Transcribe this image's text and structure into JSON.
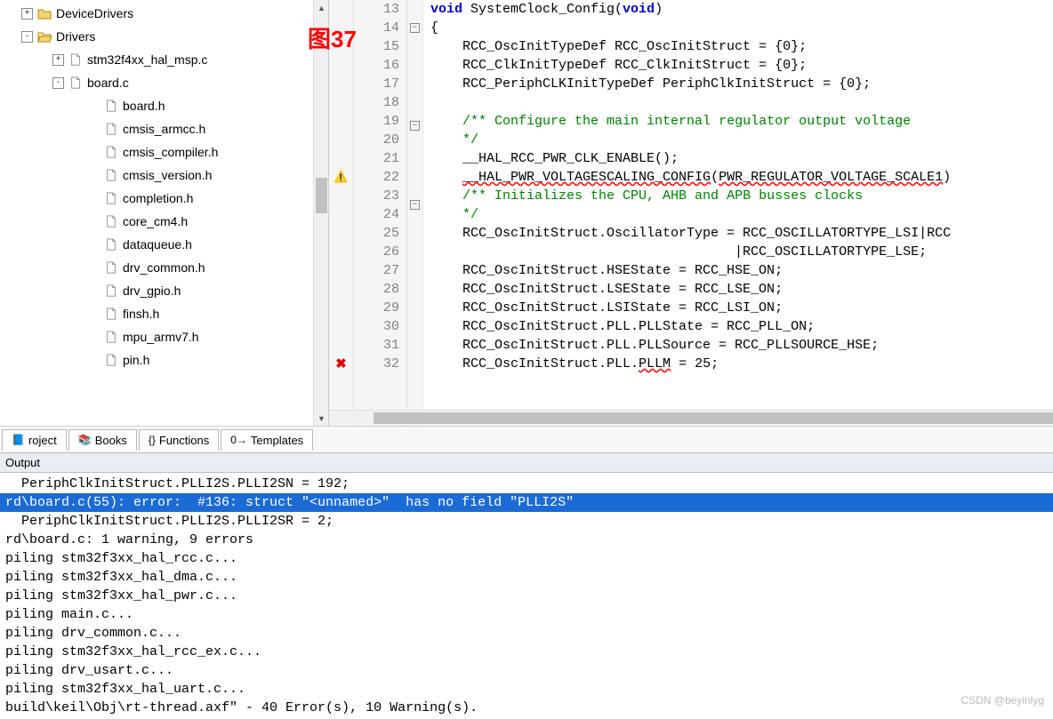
{
  "annotation": "图37",
  "tree": {
    "nodes": [
      {
        "indent": 20,
        "toggle": "+",
        "icon": "folder-closed",
        "label": "DeviceDrivers"
      },
      {
        "indent": 20,
        "toggle": "-",
        "icon": "folder-open",
        "label": "Drivers"
      },
      {
        "indent": 55,
        "toggle": "+",
        "icon": "file",
        "label": "stm32f4xx_hal_msp.c"
      },
      {
        "indent": 55,
        "toggle": "-",
        "icon": "file",
        "label": "board.c"
      },
      {
        "indent": 95,
        "toggle": "",
        "icon": "file",
        "label": "board.h"
      },
      {
        "indent": 95,
        "toggle": "",
        "icon": "file",
        "label": "cmsis_armcc.h"
      },
      {
        "indent": 95,
        "toggle": "",
        "icon": "file",
        "label": "cmsis_compiler.h"
      },
      {
        "indent": 95,
        "toggle": "",
        "icon": "file",
        "label": "cmsis_version.h"
      },
      {
        "indent": 95,
        "toggle": "",
        "icon": "file",
        "label": "completion.h"
      },
      {
        "indent": 95,
        "toggle": "",
        "icon": "file",
        "label": "core_cm4.h"
      },
      {
        "indent": 95,
        "toggle": "",
        "icon": "file",
        "label": "dataqueue.h"
      },
      {
        "indent": 95,
        "toggle": "",
        "icon": "file",
        "label": "drv_common.h"
      },
      {
        "indent": 95,
        "toggle": "",
        "icon": "file",
        "label": "drv_gpio.h"
      },
      {
        "indent": 95,
        "toggle": "",
        "icon": "file",
        "label": "finsh.h"
      },
      {
        "indent": 95,
        "toggle": "",
        "icon": "file",
        "label": "mpu_armv7.h"
      },
      {
        "indent": 95,
        "toggle": "",
        "icon": "file",
        "label": "pin.h"
      }
    ]
  },
  "editor": {
    "lines": [
      {
        "n": 13,
        "marker": "",
        "fold": "",
        "parts": [
          {
            "t": "void ",
            "c": "kw"
          },
          {
            "t": "SystemClock_Config("
          },
          {
            "t": "void",
            "c": "kw"
          },
          {
            "t": ")"
          }
        ]
      },
      {
        "n": 14,
        "marker": "",
        "fold": "-",
        "parts": [
          {
            "t": "{"
          }
        ]
      },
      {
        "n": 15,
        "marker": "",
        "fold": "",
        "parts": [
          {
            "t": "    RCC_OscInitTypeDef RCC_OscInitStruct = {0};"
          }
        ]
      },
      {
        "n": 16,
        "marker": "",
        "fold": "",
        "parts": [
          {
            "t": "    RCC_ClkInitTypeDef RCC_ClkInitStruct = {0};"
          }
        ]
      },
      {
        "n": 17,
        "marker": "",
        "fold": "",
        "parts": [
          {
            "t": "    RCC_PeriphCLKInitTypeDef PeriphClkInitStruct = {0};"
          }
        ]
      },
      {
        "n": 18,
        "marker": "",
        "fold": "",
        "parts": [
          {
            "t": ""
          }
        ]
      },
      {
        "n": 19,
        "marker": "",
        "fold": "-",
        "parts": [
          {
            "t": "    "
          },
          {
            "t": "/** Configure the main internal regulator output voltage",
            "c": "cm"
          }
        ]
      },
      {
        "n": 20,
        "marker": "",
        "fold": "",
        "parts": [
          {
            "t": "    "
          },
          {
            "t": "*/",
            "c": "cm"
          }
        ]
      },
      {
        "n": 21,
        "marker": "",
        "fold": "",
        "parts": [
          {
            "t": "    __HAL_RCC_PWR_CLK_ENABLE();"
          }
        ]
      },
      {
        "n": 22,
        "marker": "warn",
        "fold": "",
        "parts": [
          {
            "t": "    "
          },
          {
            "t": "__HAL_PWR_VOLTAGESCALING_CONFIG",
            "c": "err-underline"
          },
          {
            "t": "("
          },
          {
            "t": "PWR_REGULATOR_VOLTAGE_SCALE1",
            "c": "err-underline"
          },
          {
            "t": ")"
          }
        ]
      },
      {
        "n": 23,
        "marker": "",
        "fold": "-",
        "parts": [
          {
            "t": "    "
          },
          {
            "t": "/** Initializes the CPU, AHB and APB busses clocks",
            "c": "cm"
          }
        ]
      },
      {
        "n": 24,
        "marker": "",
        "fold": "",
        "parts": [
          {
            "t": "    "
          },
          {
            "t": "*/",
            "c": "cm"
          }
        ]
      },
      {
        "n": 25,
        "marker": "",
        "fold": "",
        "parts": [
          {
            "t": "    RCC_OscInitStruct.OscillatorType = RCC_OSCILLATORTYPE_LSI|RCC"
          }
        ]
      },
      {
        "n": 26,
        "marker": "",
        "fold": "",
        "parts": [
          {
            "t": "                                      |RCC_OSCILLATORTYPE_LSE;"
          }
        ]
      },
      {
        "n": 27,
        "marker": "",
        "fold": "",
        "parts": [
          {
            "t": "    RCC_OscInitStruct.HSEState = RCC_HSE_ON;"
          }
        ]
      },
      {
        "n": 28,
        "marker": "",
        "fold": "",
        "parts": [
          {
            "t": "    RCC_OscInitStruct.LSEState = RCC_LSE_ON;"
          }
        ]
      },
      {
        "n": 29,
        "marker": "",
        "fold": "",
        "parts": [
          {
            "t": "    RCC_OscInitStruct.LSIState = RCC_LSI_ON;"
          }
        ]
      },
      {
        "n": 30,
        "marker": "",
        "fold": "",
        "parts": [
          {
            "t": "    RCC_OscInitStruct.PLL.PLLState = RCC_PLL_ON;"
          }
        ]
      },
      {
        "n": 31,
        "marker": "",
        "fold": "",
        "parts": [
          {
            "t": "    RCC_OscInitStruct.PLL.PLLSource = RCC_PLLSOURCE_HSE;"
          }
        ]
      },
      {
        "n": 32,
        "marker": "err",
        "fold": "",
        "parts": [
          {
            "t": "    RCC_OscInitStruct.PLL."
          },
          {
            "t": "PLLM",
            "c": "err-underline"
          },
          {
            "t": " = 25;"
          }
        ]
      }
    ]
  },
  "bottom_tabs": [
    {
      "icon": "📘",
      "label": "roject"
    },
    {
      "icon": "📚",
      "label": "Books"
    },
    {
      "icon": "{}",
      "label": "Functions"
    },
    {
      "icon": "0→",
      "label": "Templates"
    }
  ],
  "output": {
    "title": "Output",
    "lines": [
      {
        "t": "  PeriphClkInitStruct.PLLI2S.PLLI2SN = 192;",
        "sel": false
      },
      {
        "t": "rd\\board.c(55): error:  #136: struct \"<unnamed>\"  has no field \"PLLI2S\"",
        "sel": true
      },
      {
        "t": "  PeriphClkInitStruct.PLLI2S.PLLI2SR = 2;",
        "sel": false
      },
      {
        "t": "rd\\board.c: 1 warning, 9 errors",
        "sel": false
      },
      {
        "t": "piling stm32f3xx_hal_rcc.c...",
        "sel": false
      },
      {
        "t": "piling stm32f3xx_hal_dma.c...",
        "sel": false
      },
      {
        "t": "piling stm32f3xx_hal_pwr.c...",
        "sel": false
      },
      {
        "t": "piling main.c...",
        "sel": false
      },
      {
        "t": "piling drv_common.c...",
        "sel": false
      },
      {
        "t": "piling stm32f3xx_hal_rcc_ex.c...",
        "sel": false
      },
      {
        "t": "piling drv_usart.c...",
        "sel": false
      },
      {
        "t": "piling stm32f3xx_hal_uart.c...",
        "sel": false
      },
      {
        "t": "build\\keil\\Obj\\rt-thread.axf\" - 40 Error(s), 10 Warning(s).",
        "sel": false
      }
    ]
  },
  "watermark": "CSDN @beyinlyg"
}
